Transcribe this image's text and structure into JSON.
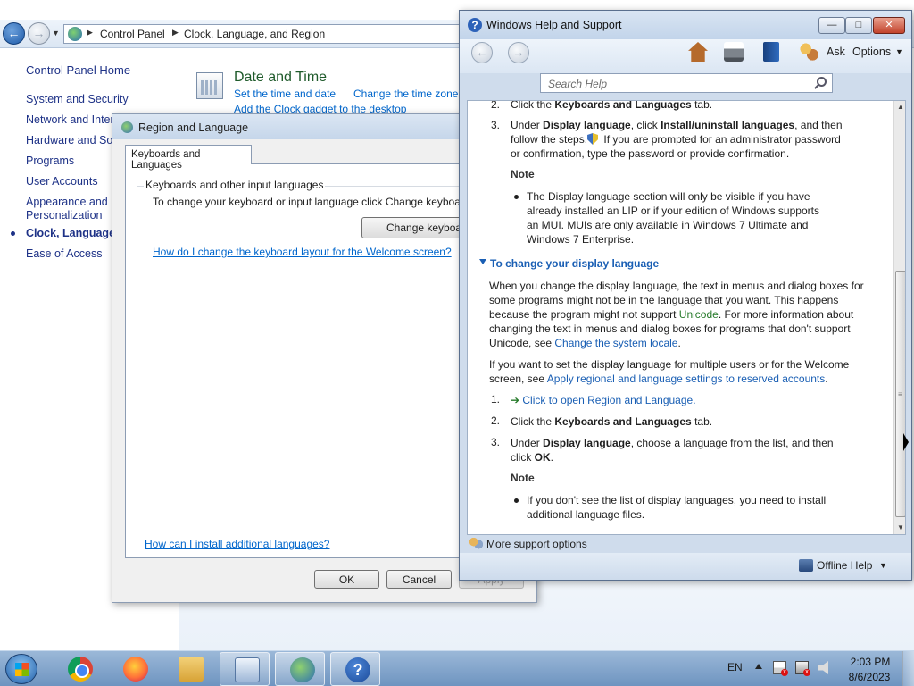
{
  "control_panel": {
    "breadcrumb": [
      "Control Panel",
      "Clock, Language, and Region"
    ],
    "sidebar": {
      "home": "Control Panel Home",
      "items": [
        "System and Security",
        "Network and Inter",
        "Hardware and Sou",
        "Programs",
        "User Accounts",
        "Appearance and",
        "Personalization",
        "Clock, Language, a",
        "Ease of Access"
      ]
    },
    "date_time": {
      "title": "Date and Time",
      "link1": "Set the time and date",
      "link2": "Change the time zone",
      "link3": "Add the Clock gadget to the desktop"
    }
  },
  "region_dialog": {
    "title": "Region and Language",
    "tab": "Keyboards and Languages",
    "group_title": "Keyboards and other input languages",
    "group_text": "To change your keyboard or input language click Change keyboards.",
    "change_button": "Change keyboards...",
    "welcome_link": "How do I change the keyboard layout for the Welcome screen?",
    "install_link": "How can I install additional languages?",
    "ok": "OK",
    "cancel": "Cancel",
    "apply": "Apply"
  },
  "help_window": {
    "title": "Windows Help and Support",
    "ask": "Ask",
    "options": "Options",
    "search_placeholder": "Search Help",
    "content": {
      "step2a_num": "2.",
      "step2a_pre": "Click the ",
      "step2a_bold": "Keyboards and Languages",
      "step2a_post": " tab.",
      "step3a_num": "3.",
      "step3a_l1_pre": "Under ",
      "step3a_l1_bold1": "Display language",
      "step3a_l1_mid": ", click ",
      "step3a_l1_bold2": "Install/uninstall languages",
      "step3a_l1_post": ", and then",
      "step3a_l2": "follow the steps.",
      "step3a_l2b": " If you are prompted for an administrator password",
      "step3a_l3": "or confirmation, type the password or provide confirmation.",
      "note1": "Note",
      "note1_lines": [
        "The Display language section will only be visible if you have",
        "already installed an LIP or if your edition of Windows supports",
        "an MUI. MUIs are only available in Windows 7 Ultimate and",
        "Windows 7 Enterprise."
      ],
      "section_title": "To change your display language",
      "para1_l1": "When you change the display language, the text in menus and dialog boxes for",
      "para1_l2": "some programs might not be in the language that you want. This happens",
      "para1_l3_pre": "because the program might not support ",
      "para1_l3_link": "Unicode",
      "para1_l3_post": ". For more information about",
      "para1_l4": "changing the text in menus and dialog boxes for programs that don't support",
      "para1_l5_pre": "Unicode, see ",
      "para1_l5_link": "Change the system locale",
      "para1_l5_post": ".",
      "para2_l1": "If you want to set the display language for multiple users or for the Welcome",
      "para2_l2_pre": "screen, see ",
      "para2_l2_link": "Apply regional and language settings to reserved accounts",
      "para2_l2_post": ".",
      "step1_num": "1.",
      "step1_link": "Click to open Region and Language.",
      "step2b_num": "2.",
      "step2b_pre": "Click the ",
      "step2b_bold": "Keyboards and Languages",
      "step2b_post": " tab.",
      "step3b_num": "3.",
      "step3b_l1_pre": "Under ",
      "step3b_l1_bold": "Display language",
      "step3b_l1_post": ", choose a language from the list, and then",
      "step3b_l2_pre": "click ",
      "step3b_l2_bold": "OK",
      "step3b_l2_post": ".",
      "note2": "Note",
      "note2_lines": [
        "If you don't see the list of display languages, you need to install",
        "additional language files."
      ]
    },
    "more_support": "More support options",
    "offline_help": "Offline Help"
  },
  "taskbar": {
    "lang": "EN",
    "time": "2:03 PM",
    "date": "8/6/2023"
  }
}
